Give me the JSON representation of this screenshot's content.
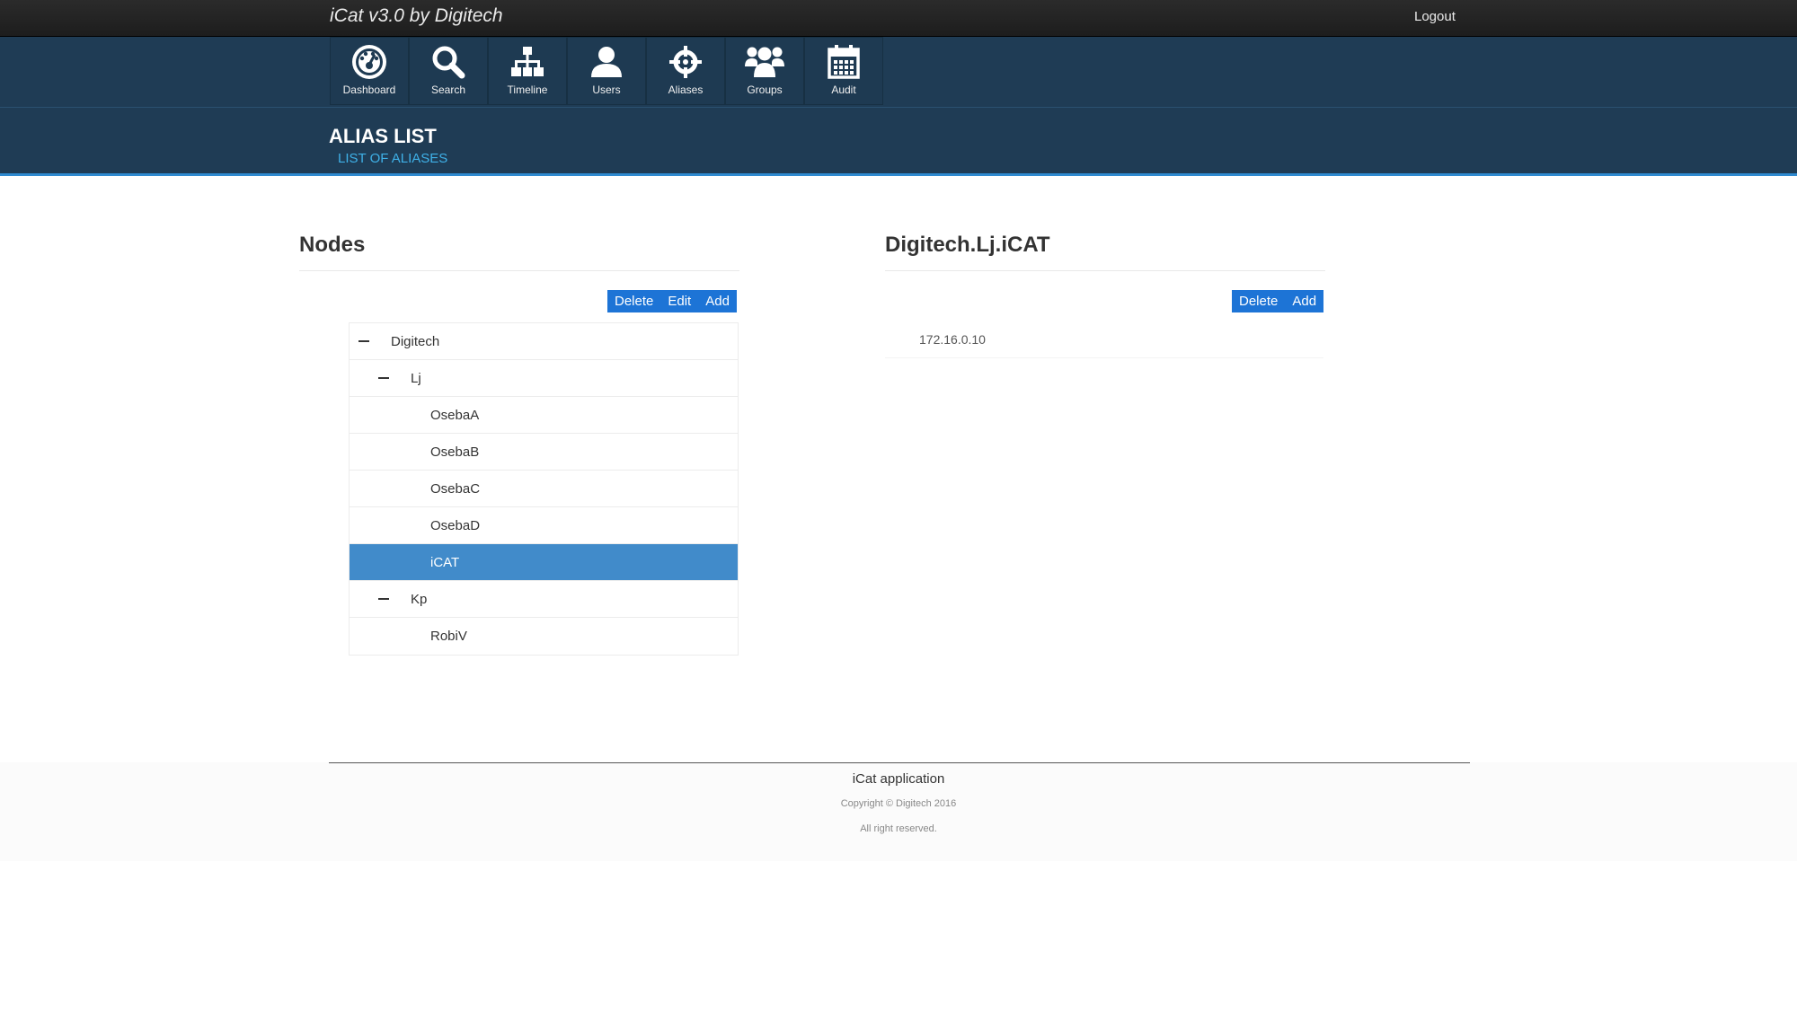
{
  "topbar": {
    "brand": "iCat v3.0 by Digitech",
    "logout": "Logout"
  },
  "nav": {
    "items": [
      {
        "label": "Dashboard",
        "icon": "dashboard-gauge-icon"
      },
      {
        "label": "Search",
        "icon": "search-icon"
      },
      {
        "label": "Timeline",
        "icon": "sitemap-icon"
      },
      {
        "label": "Users",
        "icon": "user-icon"
      },
      {
        "label": "Aliases",
        "icon": "crosshair-icon"
      },
      {
        "label": "Groups",
        "icon": "group-icon"
      },
      {
        "label": "Audit",
        "icon": "calendar-icon"
      }
    ]
  },
  "page": {
    "title": "ALIAS LIST",
    "subtitle": "LIST OF ALIASES"
  },
  "nodes": {
    "heading": "Nodes",
    "buttons": {
      "delete": "Delete",
      "edit": "Edit",
      "add": "Add"
    },
    "tree": [
      {
        "label": "Digitech",
        "level": 0,
        "expanded": true,
        "selected": false
      },
      {
        "label": "Lj",
        "level": 1,
        "expanded": true,
        "selected": false
      },
      {
        "label": "OsebaA",
        "level": 2,
        "selected": false
      },
      {
        "label": "OsebaB",
        "level": 2,
        "selected": false
      },
      {
        "label": "OsebaC",
        "level": 2,
        "selected": false
      },
      {
        "label": "OsebaD",
        "level": 2,
        "selected": false
      },
      {
        "label": "iCAT",
        "level": 2,
        "selected": true
      },
      {
        "label": "Kp",
        "level": 1,
        "expanded": true,
        "selected": false
      },
      {
        "label": "RobiV",
        "level": 2,
        "selected": false
      }
    ]
  },
  "aliases": {
    "heading": "Digitech.Lj.iCAT",
    "buttons": {
      "delete": "Delete",
      "add": "Add"
    },
    "items": [
      "172.16.0.10"
    ]
  },
  "footer": {
    "app": "iCat application",
    "copyright": "Copyright © Digitech 2016",
    "rights": "All right reserved."
  },
  "colors": {
    "topbar": "#222222",
    "navband": "#1f3c55",
    "accent": "#2f8ad0",
    "subtitle": "#3fb1e8",
    "button": "#1d74d6",
    "selected_row": "#418bca"
  }
}
